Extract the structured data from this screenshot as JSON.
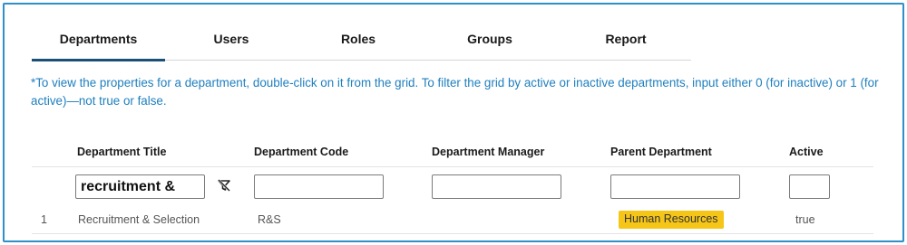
{
  "tabs": [
    {
      "label": "Departments",
      "active": true
    },
    {
      "label": "Users",
      "active": false
    },
    {
      "label": "Roles",
      "active": false
    },
    {
      "label": "Groups",
      "active": false
    },
    {
      "label": "Report",
      "active": false
    }
  ],
  "instructions": "*To view the properties for a department, double-click on it from the grid. To filter the grid by active or inactive departments, input either 0 (for inactive) or 1 (for active)—not true or false.",
  "grid": {
    "columns": [
      "Department Title",
      "Department Code",
      "Department Manager",
      "Parent Department",
      "Active"
    ],
    "filters": {
      "department_title": "recruitment &",
      "department_code": "",
      "department_manager": "",
      "parent_department": "",
      "active": ""
    },
    "rows": [
      {
        "index": "1",
        "department_title": "Recruitment & Selection",
        "department_code": "R&S",
        "department_manager": "",
        "parent_department": "Human Resources",
        "active": "true"
      }
    ]
  },
  "colors": {
    "frame_border": "#2f8fc9",
    "instruction_text": "#1e7fbf",
    "active_tab_underline": "#1a4f78",
    "badge_background": "#f5c518"
  },
  "icons": {
    "filter_clear": "filter-clear-icon"
  }
}
